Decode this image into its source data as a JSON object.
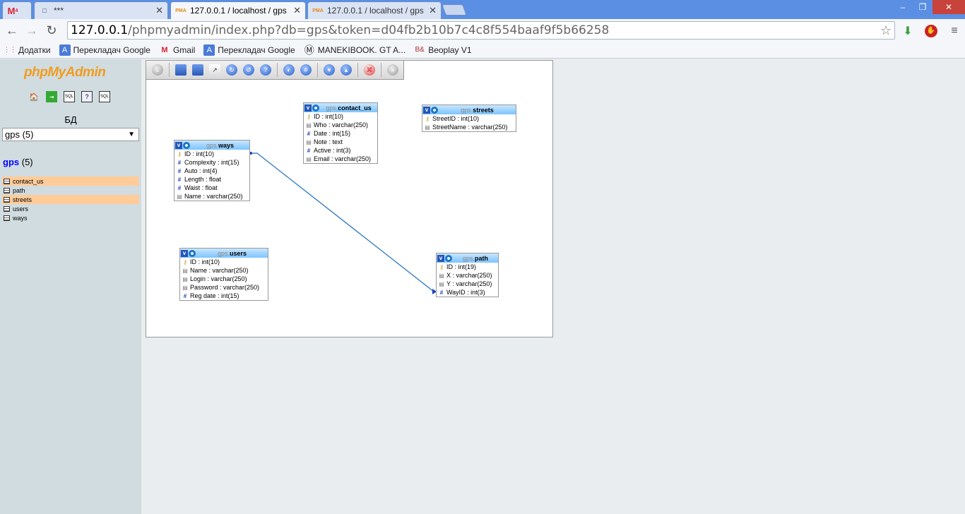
{
  "browser": {
    "tabs": [
      {
        "icon": "gmail-icon",
        "glyph": "M",
        "badge": "4",
        "title": ""
      },
      {
        "icon": "document-icon",
        "glyph": "□",
        "title": "***"
      },
      {
        "icon": "pma-icon",
        "glyph": "PMA",
        "title": "127.0.0.1 / localhost / gps"
      },
      {
        "icon": "pma-icon",
        "glyph": "PMA",
        "title": "127.0.0.1 / localhost / gps"
      }
    ],
    "window_controls": {
      "minimize": "–",
      "restore": "❐",
      "close": "✕"
    },
    "nav": {
      "back": "←",
      "forward": "→",
      "reload": "↻"
    },
    "url": {
      "host": "127.0.0.1",
      "path": "/phpmyadmin/index.php?db=gps&token=d04fb2b10b7c4c8f554baaf9f5b66258"
    },
    "bookmarks": [
      {
        "icon": "apps-icon",
        "glyph": "⋮⋮",
        "label": "Додатки"
      },
      {
        "icon": "translate-icon",
        "glyph": "A",
        "label": "Перекладач Google"
      },
      {
        "icon": "gmail-icon",
        "glyph": "M",
        "label": "Gmail"
      },
      {
        "icon": "translate-icon",
        "glyph": "A",
        "label": "Перекладач Google"
      },
      {
        "icon": "maneki-icon",
        "glyph": "Ⓜ",
        "label": "MANEKIBOOK. GT A..."
      },
      {
        "icon": "beoplay-icon",
        "glyph": "B&",
        "label": "Beoplay V1"
      }
    ]
  },
  "sidebar": {
    "logo_a": "php",
    "logo_b": "MyAdmin",
    "db_label": "БД",
    "db_select": "gps (5)",
    "db_name": "gps",
    "db_count": " (5)",
    "tables": [
      "contact_us",
      "path",
      "streets",
      "users",
      "ways"
    ]
  },
  "designer": {
    "tables": [
      {
        "id": "contact_us",
        "db": "gps.",
        "name": "contact_us",
        "fields": [
          {
            "t": "key",
            "text": "ID : int(10)"
          },
          {
            "t": "str",
            "text": "Who : varchar(250)"
          },
          {
            "t": "num",
            "text": "Date : int(15)"
          },
          {
            "t": "str",
            "text": "Note : text"
          },
          {
            "t": "num",
            "text": "Active : int(3)"
          },
          {
            "t": "str",
            "text": "Email : varchar(250)"
          }
        ]
      },
      {
        "id": "streets",
        "db": "gps.",
        "name": "streets",
        "fields": [
          {
            "t": "key",
            "text": "StreetID : int(10)"
          },
          {
            "t": "str",
            "text": "StreetName : varchar(250)"
          }
        ]
      },
      {
        "id": "ways",
        "db": "gps.",
        "name": "ways",
        "fields": [
          {
            "t": "key",
            "text": "ID : int(10)"
          },
          {
            "t": "num",
            "text": "Complexity : int(15)"
          },
          {
            "t": "num",
            "text": "Auto : int(4)"
          },
          {
            "t": "num",
            "text": "Length : float"
          },
          {
            "t": "num",
            "text": "Waist : float"
          },
          {
            "t": "str",
            "text": "Name : varchar(250)"
          }
        ]
      },
      {
        "id": "users",
        "db": "gps.",
        "name": "users",
        "fields": [
          {
            "t": "key",
            "text": "ID : int(10)"
          },
          {
            "t": "str",
            "text": "Name : varchar(250)"
          },
          {
            "t": "str",
            "text": "Login : varchar(250)"
          },
          {
            "t": "str",
            "text": "Password : varchar(250)"
          },
          {
            "t": "num",
            "text": "Reg date : int(15)"
          }
        ]
      },
      {
        "id": "path",
        "db": "gps.",
        "name": "path",
        "fields": [
          {
            "t": "key",
            "text": "ID : int(19)"
          },
          {
            "t": "str",
            "text": "X : varchar(250)"
          },
          {
            "t": "str",
            "text": "Y : varchar(250)"
          },
          {
            "t": "num",
            "text": "WayID : int(3)"
          }
        ]
      }
    ]
  }
}
